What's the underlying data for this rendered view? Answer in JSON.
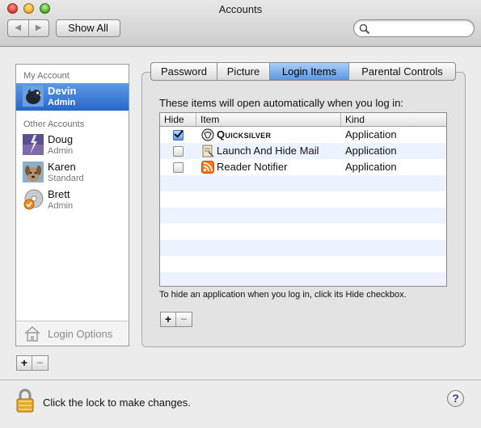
{
  "window": {
    "title": "Accounts",
    "show_all_label": "Show All",
    "back_glyph": "◀",
    "forward_glyph": "▶"
  },
  "search": {
    "value": "",
    "placeholder": ""
  },
  "sidebar": {
    "my_account_header": "My Account",
    "my_account": {
      "name": "Devin",
      "role": "Admin",
      "avatar": "bird-avatar"
    },
    "other_accounts_header": "Other Accounts",
    "other_accounts": [
      {
        "name": "Doug",
        "role": "Admin",
        "avatar": "lightning-avatar"
      },
      {
        "name": "Karen",
        "role": "Standard",
        "avatar": "dog-avatar"
      },
      {
        "name": "Brett",
        "role": "Admin",
        "avatar": "cd-avatar"
      }
    ],
    "login_options_label": "Login Options",
    "add_label": "+",
    "remove_label": "−"
  },
  "tabs": [
    {
      "label": "Password",
      "active": false
    },
    {
      "label": "Picture",
      "active": false
    },
    {
      "label": "Login Items",
      "active": true
    },
    {
      "label": "Parental Controls",
      "active": false
    }
  ],
  "login_items": {
    "intro": "These items will open automatically when you log in:",
    "columns": {
      "hide": "Hide",
      "item": "Item",
      "kind": "Kind"
    },
    "rows": [
      {
        "hide": true,
        "item": "Quicksilver",
        "kind": "Application",
        "icon": "quicksilver-icon"
      },
      {
        "hide": false,
        "item": "Launch And Hide Mail",
        "kind": "Application",
        "icon": "mail-script-icon"
      },
      {
        "hide": false,
        "item": "Reader Notifier",
        "kind": "Application",
        "icon": "rss-icon"
      }
    ],
    "hint": "To hide an application when you log in, click its Hide checkbox.",
    "add_label": "+",
    "remove_label": "−"
  },
  "footer": {
    "lock_text": "Click the lock to make changes.",
    "help_label": "?"
  },
  "colors": {
    "selection": "#3a7bd5",
    "tab_active": "#79aef0",
    "row_alt": "#edf3fe"
  }
}
